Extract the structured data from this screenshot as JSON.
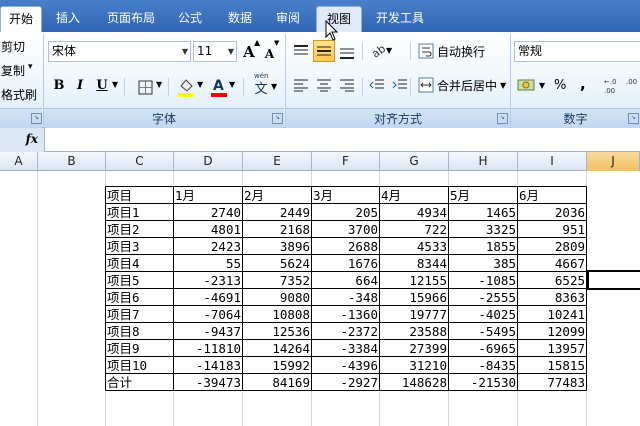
{
  "tabs": [
    {
      "label": "开始",
      "state": "active"
    },
    {
      "label": "插入",
      "state": ""
    },
    {
      "label": "页面布局",
      "state": ""
    },
    {
      "label": "公式",
      "state": ""
    },
    {
      "label": "数据",
      "state": ""
    },
    {
      "label": "审阅",
      "state": ""
    },
    {
      "label": "视图",
      "state": "hover"
    },
    {
      "label": "开发工具",
      "state": ""
    }
  ],
  "clipboard": {
    "cut": "剪切",
    "copy": "复制",
    "copy_arrow": "▾",
    "format_painter": "格式刷"
  },
  "font": {
    "group_label": "字体",
    "name": "宋体",
    "size": "11",
    "grow": "A",
    "shrink": "A",
    "bold": "B",
    "italic": "I",
    "underline": "U",
    "phonetic": "文"
  },
  "alignment": {
    "group_label": "对齐方式",
    "wrap_text": "自动换行",
    "merge_center": "合并后居中"
  },
  "number": {
    "group_label": "数字",
    "format": "常规",
    "percent": "%",
    "comma": ","
  },
  "formula_bar": {
    "fx": "fx",
    "value": ""
  },
  "columns": [
    "A",
    "B",
    "C",
    "D",
    "E",
    "F",
    "G",
    "H",
    "I",
    "J"
  ],
  "table": {
    "header": [
      "项目",
      "1月",
      "2月",
      "3月",
      "4月",
      "5月",
      "6月"
    ],
    "rows": [
      [
        "项目1",
        "2740",
        "2449",
        "205",
        "4934",
        "1465",
        "2036"
      ],
      [
        "项目2",
        "4801",
        "2168",
        "3700",
        "722",
        "3325",
        "951"
      ],
      [
        "项目3",
        "2423",
        "3896",
        "2688",
        "4533",
        "1855",
        "2809"
      ],
      [
        "项目4",
        "55",
        "5624",
        "1676",
        "8344",
        "385",
        "4667"
      ],
      [
        "项目5",
        "-2313",
        "7352",
        "664",
        "12155",
        "-1085",
        "6525"
      ],
      [
        "项目6",
        "-4691",
        "9080",
        "-348",
        "15966",
        "-2555",
        "8363"
      ],
      [
        "项目7",
        "-7064",
        "10808",
        "-1360",
        "19777",
        "-4025",
        "10241"
      ],
      [
        "项目8",
        "-9437",
        "12536",
        "-2372",
        "23588",
        "-5495",
        "12099"
      ],
      [
        "项目9",
        "-11810",
        "14264",
        "-3384",
        "27399",
        "-6965",
        "13957"
      ],
      [
        "项目10",
        "-14183",
        "15992",
        "-4396",
        "31210",
        "-8435",
        "15815"
      ],
      [
        "合计",
        "-39473",
        "84169",
        "-2927",
        "148628",
        "-21530",
        "77483"
      ]
    ]
  }
}
